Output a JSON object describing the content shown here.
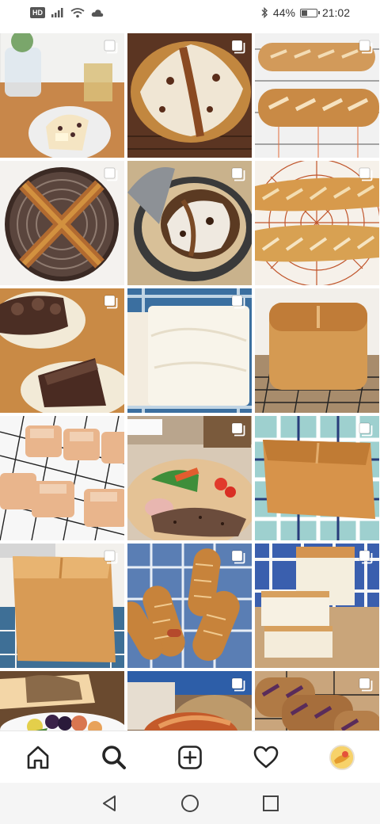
{
  "status_bar": {
    "hd_label": "HD",
    "battery_text": "44%",
    "battery_level": 0.44,
    "time": "21:02",
    "icons": [
      "signal-icon",
      "wifi-icon",
      "cloud-icon",
      "bluetooth-icon",
      "battery-icon"
    ]
  },
  "grid": {
    "tiles": [
      {
        "name": "tile-1",
        "multi": true
      },
      {
        "name": "tile-2",
        "multi": true
      },
      {
        "name": "tile-3",
        "multi": true
      },
      {
        "name": "tile-4",
        "multi": true
      },
      {
        "name": "tile-5",
        "multi": true
      },
      {
        "name": "tile-6",
        "multi": true
      },
      {
        "name": "tile-7",
        "multi": true
      },
      {
        "name": "tile-8",
        "multi": true
      },
      {
        "name": "tile-9",
        "multi": false
      },
      {
        "name": "tile-10",
        "multi": false
      },
      {
        "name": "tile-11",
        "multi": true
      },
      {
        "name": "tile-12",
        "multi": true
      },
      {
        "name": "tile-13",
        "multi": true
      },
      {
        "name": "tile-14",
        "multi": true
      },
      {
        "name": "tile-15",
        "multi": true
      },
      {
        "name": "tile-16",
        "multi": false
      },
      {
        "name": "tile-17",
        "multi": true
      },
      {
        "name": "tile-18",
        "multi": true
      }
    ]
  },
  "bottom_nav": {
    "items": [
      "home-icon",
      "search-icon",
      "new-post-icon",
      "activity-heart-icon",
      "profile-avatar"
    ],
    "active": "search-icon"
  },
  "system_nav": {
    "items": [
      "back-icon",
      "home-circle-icon",
      "recents-icon"
    ]
  },
  "colors": {
    "background": "#ffffff",
    "icon": "#262626",
    "system_nav_bg": "#f5f5f5",
    "bread_crust": "#c98a45",
    "bread_crumb": "#f3e6cc"
  }
}
